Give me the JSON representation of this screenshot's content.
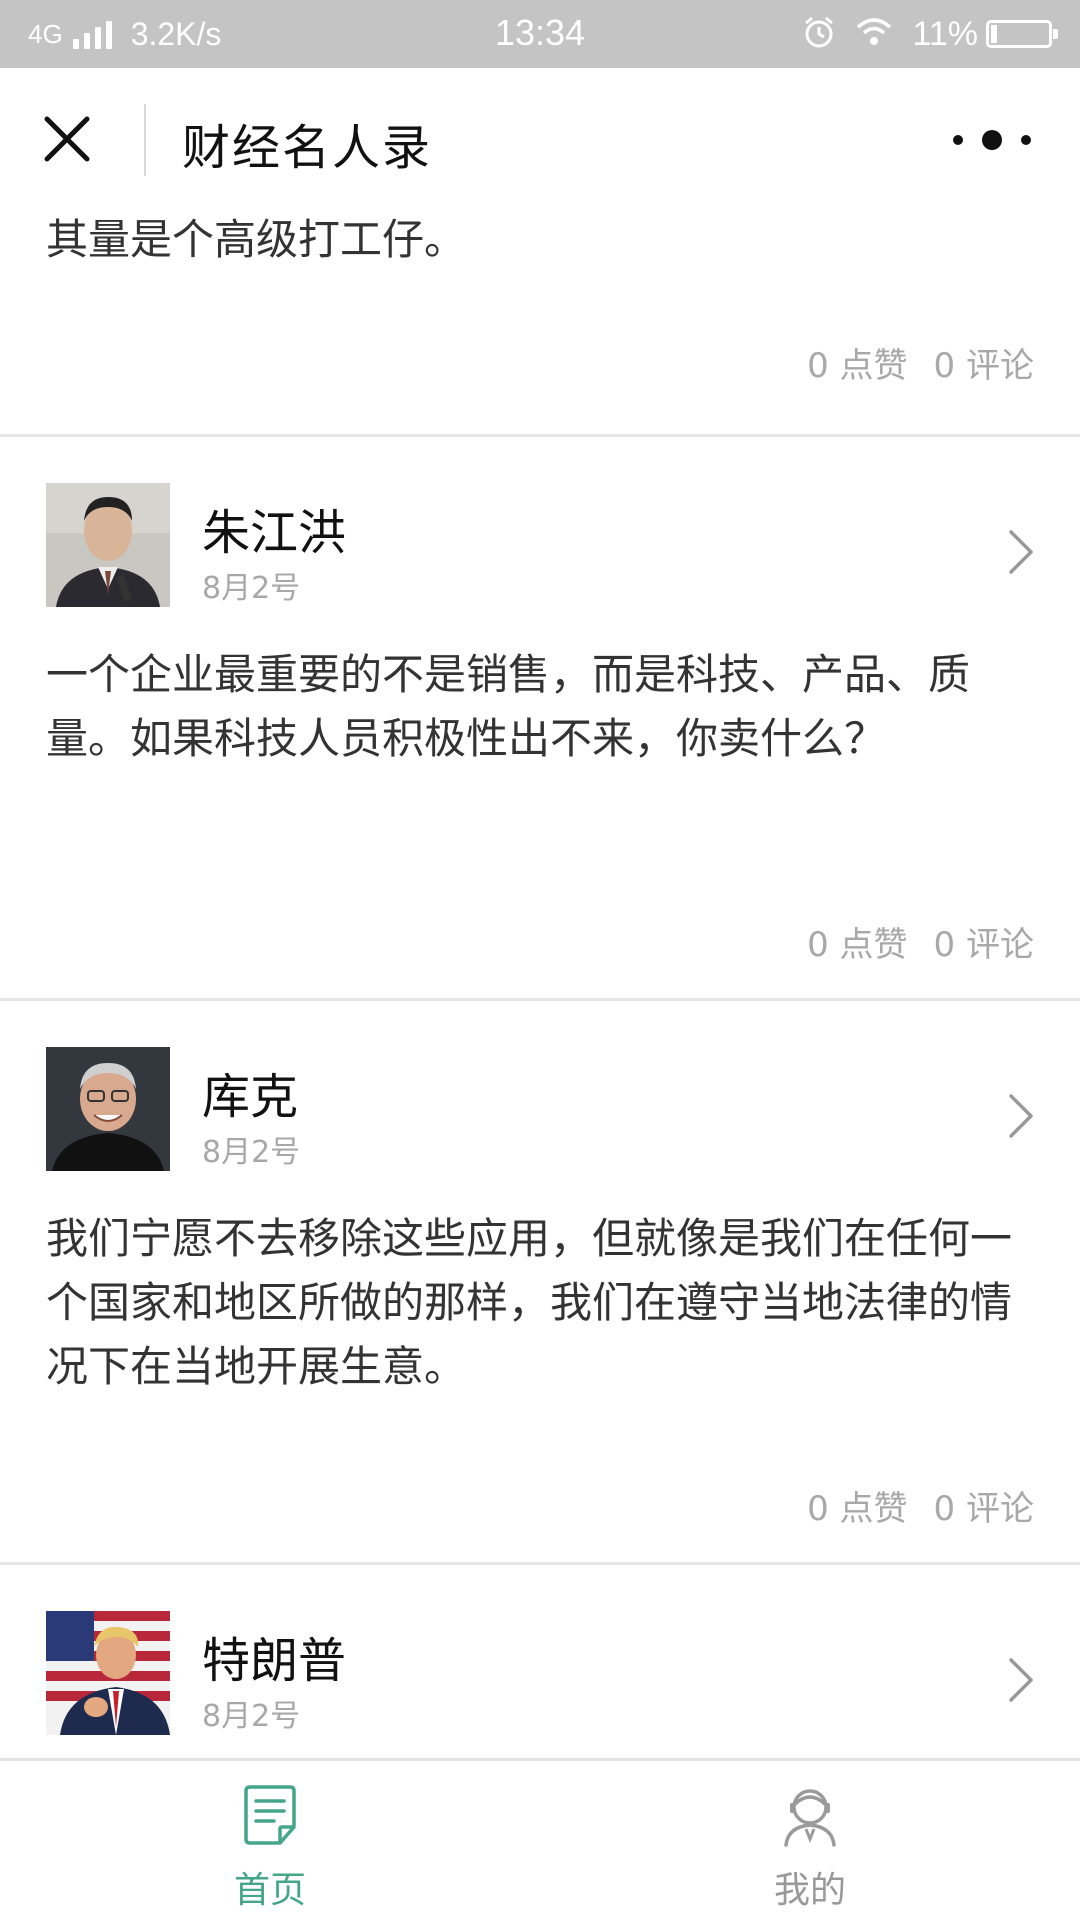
{
  "status_bar": {
    "network": "4G",
    "speed": "3.2K/s",
    "time": "13:34",
    "battery": "11%",
    "battery_level": 0.11
  },
  "nav": {
    "title": "财经名人录"
  },
  "feed": {
    "partial_post": {
      "content": "其量是个高级打工仔。",
      "likes": "0 点赞",
      "comments": "0 评论"
    },
    "posts": [
      {
        "author": "朱江洪",
        "date": "8月2号",
        "content": "一个企业最重要的不是销售，而是科技、产品、质量。如果科技人员积极性出不来，你卖什么？",
        "likes": "0 点赞",
        "comments": "0 评论"
      },
      {
        "author": "库克",
        "date": "8月2号",
        "content": "我们宁愿不去移除这些应用，但就像是我们在任何一个国家和地区所做的那样，我们在遵守当地法律的情况下在当地开展生意。",
        "likes": "0 点赞",
        "comments": "0 评论"
      },
      {
        "author": "特朗普",
        "date": "8月2号"
      }
    ]
  },
  "tabbar": {
    "home_label": "首页",
    "mine_label": "我的"
  },
  "colors": {
    "accent": "#45a58a",
    "status_bar_bg": "#c4c4c4",
    "muted_text": "#a8a8a8"
  }
}
